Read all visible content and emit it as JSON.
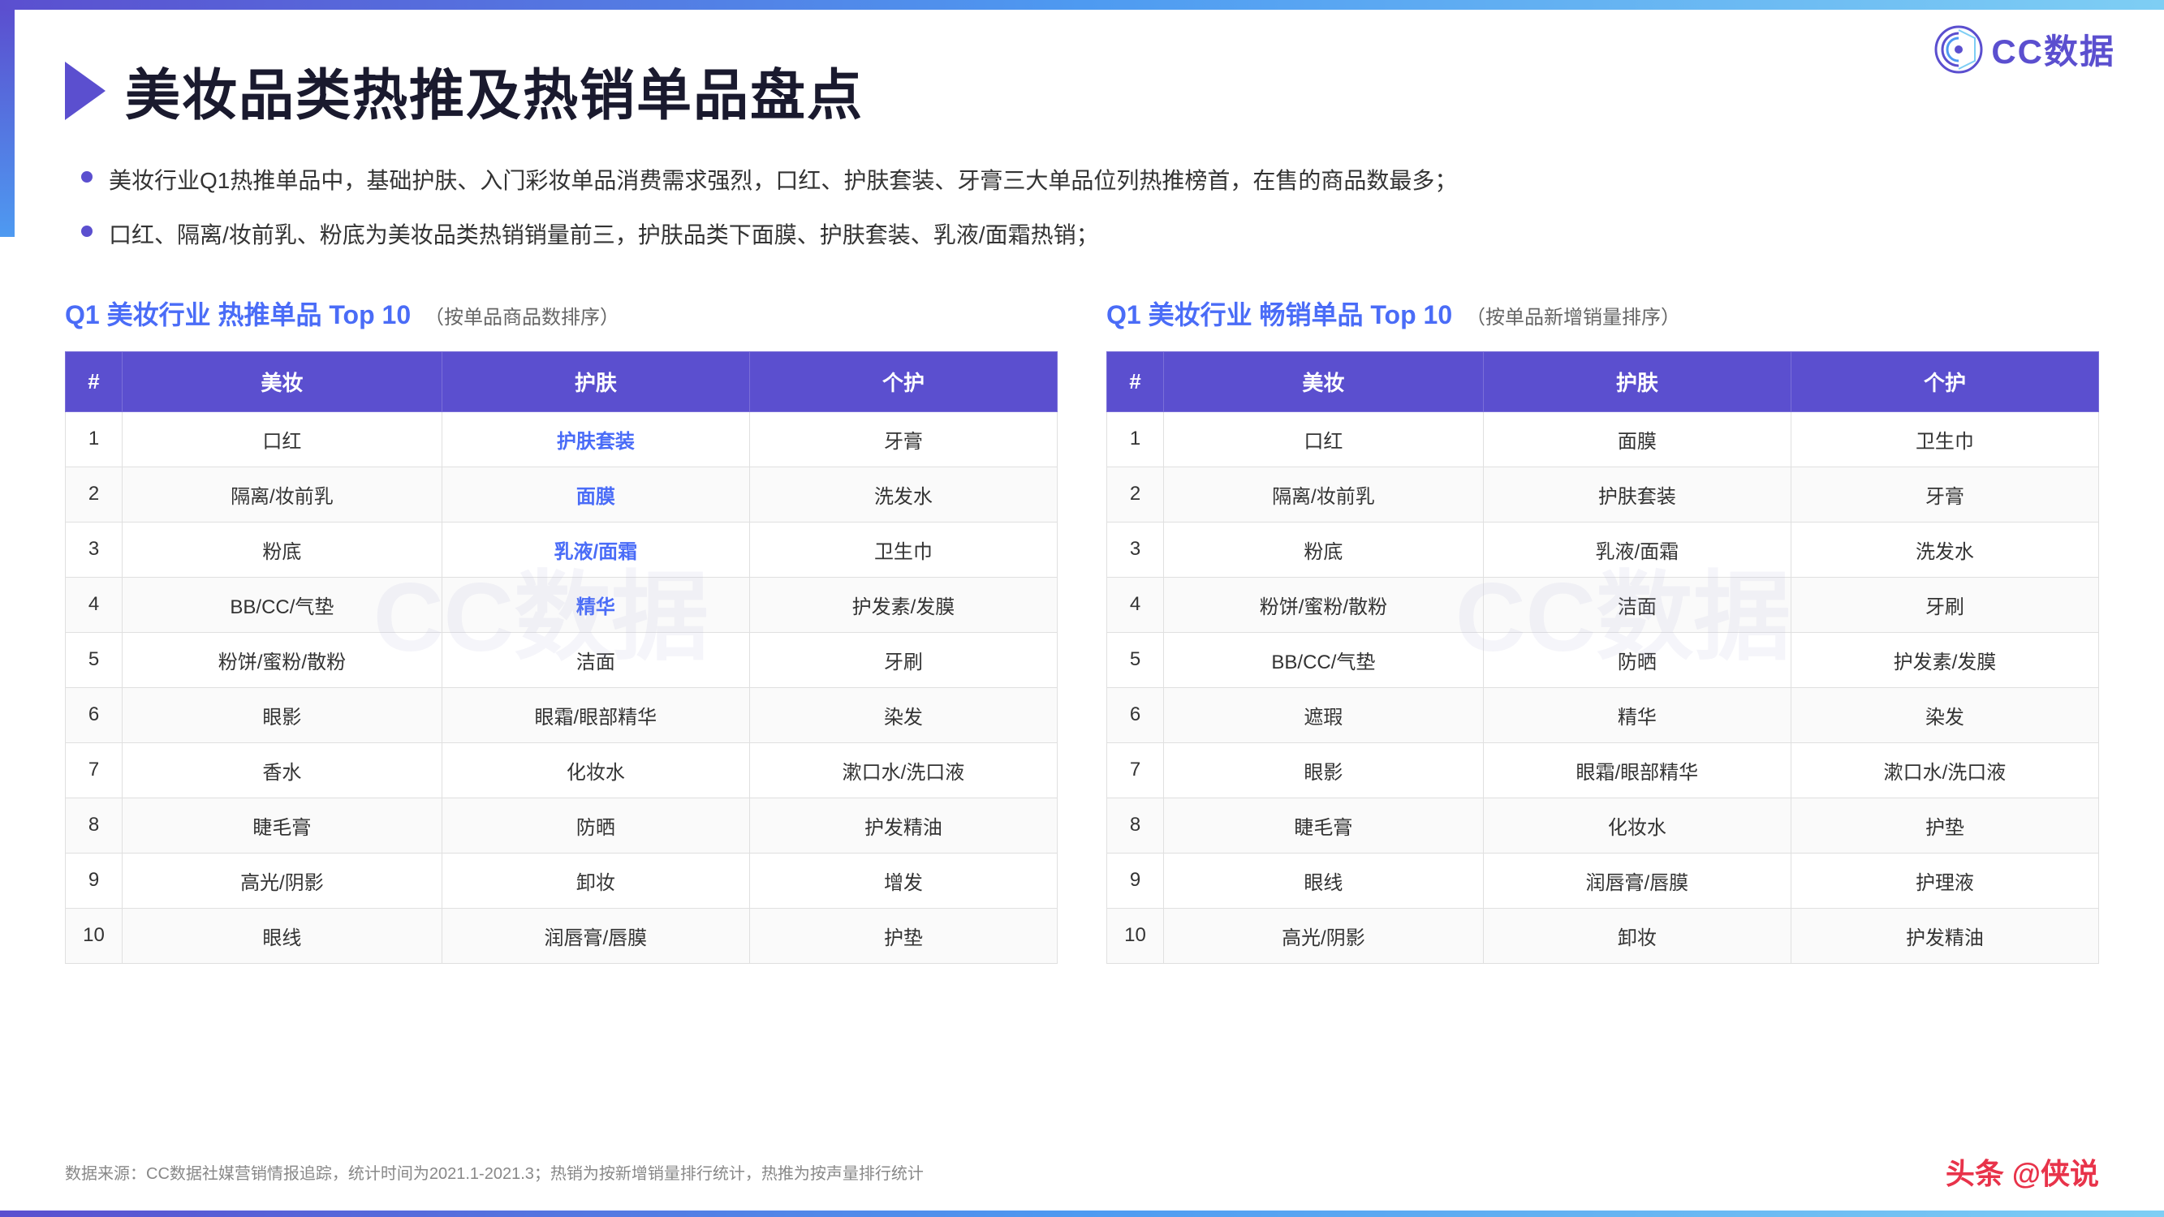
{
  "topBar": {},
  "logo": {
    "text": "CC数据",
    "icon": "cc-icon"
  },
  "title": "美妆品类热推及热销单品盘点",
  "bullets": [
    "美妆行业Q1热推单品中，基础护肤、入门彩妆单品消费需求强烈，口红、护肤套装、牙膏三大单品位列热推榜首，在售的商品数最多；",
    "口红、隔离/妆前乳、粉底为美妆品类热销销量前三，护肤品类下面膜、护肤套装、乳液/面霜热销；"
  ],
  "table1": {
    "title": "Q1 美妆行业 热推单品 Top 10",
    "subtitle": "（按单品商品数排序）",
    "headers": [
      "#",
      "美妆",
      "护肤",
      "个护"
    ],
    "rows": [
      [
        "1",
        "口红",
        "护肤套装",
        "牙膏"
      ],
      [
        "2",
        "隔离/妆前乳",
        "面膜",
        "洗发水"
      ],
      [
        "3",
        "粉底",
        "乳液/面霜",
        "卫生巾"
      ],
      [
        "4",
        "BB/CC/气垫",
        "精华",
        "护发素/发膜"
      ],
      [
        "5",
        "粉饼/蜜粉/散粉",
        "洁面",
        "牙刷"
      ],
      [
        "6",
        "眼影",
        "眼霜/眼部精华",
        "染发"
      ],
      [
        "7",
        "香水",
        "化妆水",
        "漱口水/洗口液"
      ],
      [
        "8",
        "睫毛膏",
        "防晒",
        "护发精油"
      ],
      [
        "9",
        "高光/阴影",
        "卸妆",
        "增发"
      ],
      [
        "10",
        "眼线",
        "润唇膏/唇膜",
        "护垫"
      ]
    ],
    "highlightCells": {
      "1-2": true,
      "2-2": true,
      "3-2": true,
      "4-2": true
    }
  },
  "table2": {
    "title": "Q1 美妆行业 畅销单品 Top 10",
    "subtitle": "（按单品新增销量排序）",
    "headers": [
      "#",
      "美妆",
      "护肤",
      "个护"
    ],
    "rows": [
      [
        "1",
        "口红",
        "面膜",
        "卫生巾"
      ],
      [
        "2",
        "隔离/妆前乳",
        "护肤套装",
        "牙膏"
      ],
      [
        "3",
        "粉底",
        "乳液/面霜",
        "洗发水"
      ],
      [
        "4",
        "粉饼/蜜粉/散粉",
        "洁面",
        "牙刷"
      ],
      [
        "5",
        "BB/CC/气垫",
        "防晒",
        "护发素/发膜"
      ],
      [
        "6",
        "遮瑕",
        "精华",
        "染发"
      ],
      [
        "7",
        "眼影",
        "眼霜/眼部精华",
        "漱口水/洗口液"
      ],
      [
        "8",
        "睫毛膏",
        "化妆水",
        "护垫"
      ],
      [
        "9",
        "眼线",
        "润唇膏/唇膜",
        "护理液"
      ],
      [
        "10",
        "高光/阴影",
        "卸妆",
        "护发精油"
      ]
    ]
  },
  "footer": {
    "sourceText": "数据来源：CC数据社媒营销情报追踪，统计时间为2021.1-2021.3；热销为按新增销量排行统计，热推为按声量排行统计",
    "brand": "头条 @侠说"
  },
  "watermark": "CC数据"
}
